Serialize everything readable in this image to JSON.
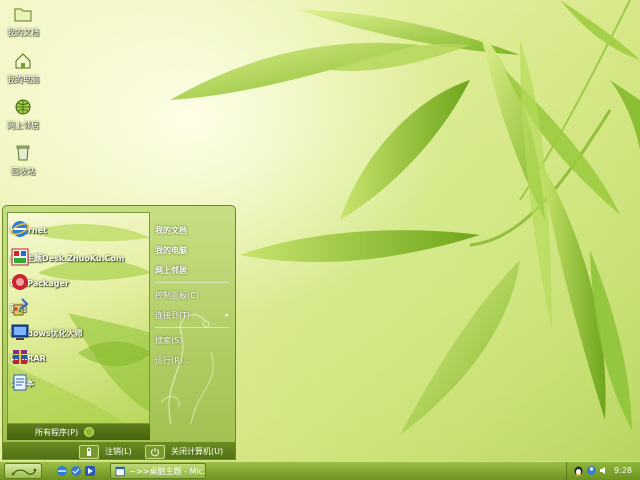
{
  "desktop": {
    "icons": [
      {
        "label": "我的文档",
        "icon": "folder-icon"
      },
      {
        "label": "我的电脑",
        "icon": "home-computer-icon"
      },
      {
        "label": "网上邻居",
        "icon": "network-globe-icon"
      },
      {
        "label": "回收站",
        "icon": "recycle-bin-icon"
      }
    ]
  },
  "start_menu": {
    "pinned": [
      {
        "label": "Internet",
        "icon": "ie-browser-icon"
      },
      {
        "label": "桌面主题Desk.ZhuoKu.Com",
        "icon": "theme-app-icon"
      },
      {
        "label": "WinPackager",
        "icon": "packager-icon"
      },
      {
        "label": "画图",
        "icon": "paint-icon"
      },
      {
        "label": "Windows优化大师",
        "icon": "optimizer-icon"
      },
      {
        "label": "WinRAR",
        "icon": "winrar-icon"
      },
      {
        "label": "记事本",
        "icon": "notepad-icon"
      }
    ],
    "all_programs": "所有程序(P)",
    "right_items": [
      {
        "label": "我的文档",
        "bold": true
      },
      {
        "label": "我的电脑",
        "bold": true
      },
      {
        "label": "网上邻居",
        "bold": true
      },
      {
        "label": "控制面板(C)",
        "bold": false
      },
      {
        "label": "连接到(T)",
        "bold": false,
        "submenu": true
      },
      {
        "label": "搜索(S)",
        "bold": false
      },
      {
        "label": "运行(R)...",
        "bold": false
      }
    ],
    "logoff": "注销(L)",
    "shutdown": "关闭计算机(U)"
  },
  "taskbar": {
    "task_label": "~>>桌酷主题 - Mic...",
    "clock": "9:28"
  },
  "colors": {
    "accent": "#6e9222",
    "menu_bg": "#9fbf4e"
  }
}
